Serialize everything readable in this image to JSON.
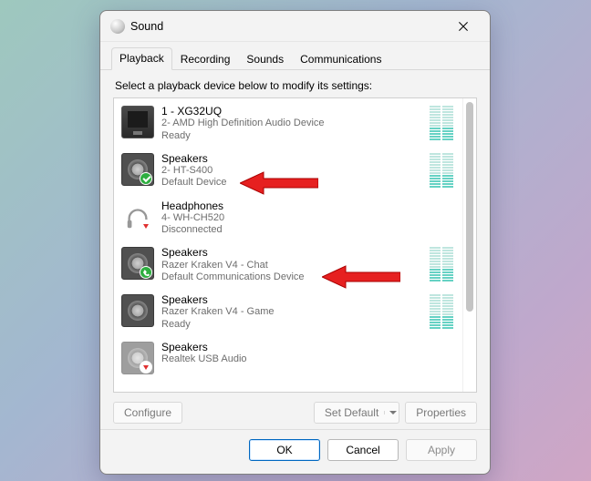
{
  "window": {
    "title": "Sound",
    "close_tooltip": "Close"
  },
  "tabs": [
    {
      "label": "Playback",
      "selected": true
    },
    {
      "label": "Recording",
      "selected": false
    },
    {
      "label": "Sounds",
      "selected": false
    },
    {
      "label": "Communications",
      "selected": false
    }
  ],
  "prompt": "Select a playback device below to modify its settings:",
  "devices": [
    {
      "name": "1 - XG32UQ",
      "subtitle": "2- AMD High Definition Audio Device",
      "status": "Ready",
      "icon": "monitor",
      "badge": null,
      "show_level": true
    },
    {
      "name": "Speakers",
      "subtitle": "2- HT-S400",
      "status": "Default Device",
      "icon": "speaker",
      "badge": "check",
      "arrow": true,
      "show_level": true
    },
    {
      "name": "Headphones",
      "subtitle": "4- WH-CH520",
      "status": "Disconnected",
      "icon": "headphones",
      "badge": "download",
      "show_level": false
    },
    {
      "name": "Speakers",
      "subtitle": "Razer Kraken V4 - Chat",
      "status": "Default Communications Device",
      "icon": "speaker",
      "badge": "call",
      "arrow": true,
      "show_level": true
    },
    {
      "name": "Speakers",
      "subtitle": "Razer Kraken V4 - Game",
      "status": "Ready",
      "icon": "speaker",
      "badge": null,
      "show_level": true
    },
    {
      "name": "Speakers",
      "subtitle": "Realtek USB Audio",
      "status": "",
      "icon": "speaker",
      "badge": "download",
      "muted": true,
      "show_level": false
    }
  ],
  "actions": {
    "configure": "Configure",
    "set_default": "Set Default",
    "properties": "Properties"
  },
  "dialog_buttons": {
    "ok": "OK",
    "cancel": "Cancel",
    "apply": "Apply"
  }
}
